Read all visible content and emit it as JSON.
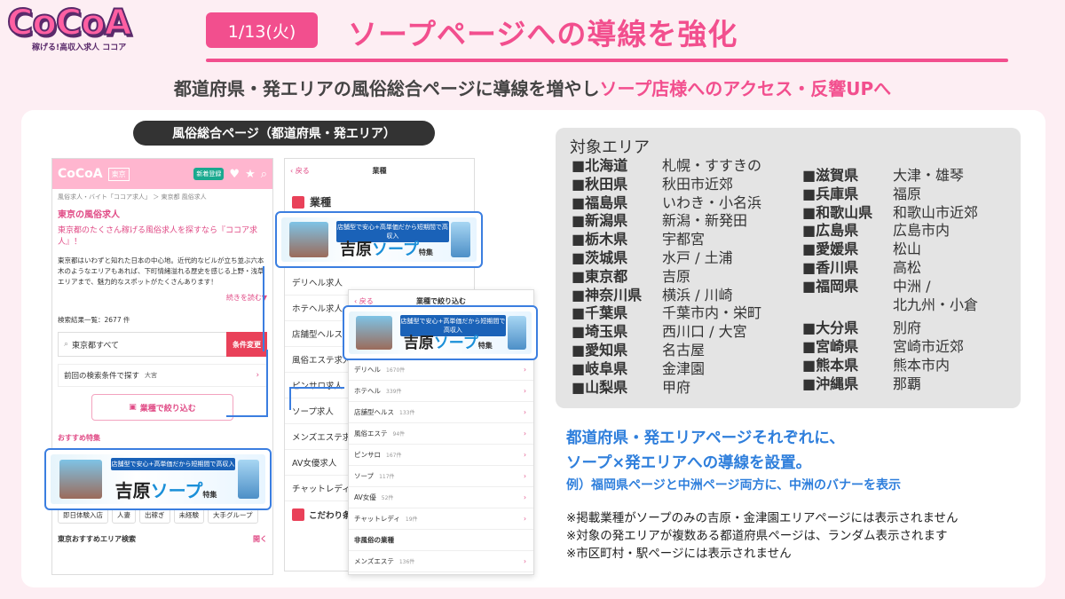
{
  "logo": {
    "brand": "CoCoA",
    "sub": "稼げる!高収入求人 ココア"
  },
  "header": {
    "date": "1/13(火)",
    "headline": "ソープページへの導線を強化"
  },
  "subline": {
    "part1": "都道府県・発エリアの風俗総合ページに導線を増やし",
    "part2": "ソープ店様へのアクセス・反響UPへ"
  },
  "screens_caption": "風俗総合ページ（都道府県・発エリア）",
  "banner": {
    "strip": "店舗型で安心+高単価だから短期間で高収入",
    "main_pre": "吉原",
    "main_so": "ソープ",
    "tokushu": "特集"
  },
  "phone1": {
    "area_btn": "東京",
    "new_btn": "新着登録",
    "crumb": "風俗求人・バイト「ココア求人」 ＞ 東京都 風俗求人",
    "h1": "東京の風俗求人",
    "lead": "東京都のたくさん稼げる風俗求人を探すなら『ココア求人』！",
    "body": "東京都はいわずと知れた日本の中心地。近代的なビルが立ち並ぶ六本木のようなエリアもあれば、下町情緒溢れる歴史を感じる上野・浅草エリアまで、魅力的なスポットがたくさんあります！",
    "more": "続きを読む▼",
    "count": "検索結果一覧：2677 件",
    "search": "東京都すべて",
    "change": "条件変更",
    "prev": "前回の検索条件で探す",
    "prev_sub": "大宮",
    "filter": "業種で絞り込む",
    "rec": "おすすめ特集",
    "tags": [
      "即日体験入店",
      "人妻",
      "出稼ぎ",
      "未経験",
      "大手グループ"
    ],
    "foot": "東京おすすめエリア検索",
    "foot_open": "開く"
  },
  "phone2": {
    "back": "戻る",
    "title": "業種",
    "section": "業種",
    "items": [
      "デリヘル求人",
      "ホテヘル求人",
      "店舗型ヘルス求",
      "風俗エステ求人",
      "ピンサロ求人",
      "ソープ求人",
      "メンズエステ求",
      "AV女優求人",
      "チャットレディ"
    ],
    "kodawari": "こだわり条"
  },
  "phone3": {
    "back": "戻る",
    "title": "業種で絞り込む",
    "items": [
      {
        "name": "デリヘル",
        "count": "1670件"
      },
      {
        "name": "ホテヘル",
        "count": "339件"
      },
      {
        "name": "店舗型ヘルス",
        "count": "133件"
      },
      {
        "name": "風俗エステ",
        "count": "94件"
      },
      {
        "name": "ピンサロ",
        "count": "167件"
      },
      {
        "name": "ソープ",
        "count": "117件"
      },
      {
        "name": "AV女優",
        "count": "52件"
      },
      {
        "name": "チャットレディ",
        "count": "19件"
      },
      {
        "name": "非風俗の業種",
        "count": ""
      },
      {
        "name": "メンズエステ",
        "count": "136件"
      }
    ]
  },
  "areas": {
    "title": "対象エリア",
    "left": [
      {
        "pref": "■北海道",
        "city": "札幌・すすきの"
      },
      {
        "pref": "■秋田県",
        "city": "秋田市近郊"
      },
      {
        "pref": "■福島県",
        "city": "いわき・小名浜"
      },
      {
        "pref": "■新潟県",
        "city": "新潟・新発田"
      },
      {
        "pref": "■栃木県",
        "city": "宇都宮"
      },
      {
        "pref": "■茨城県",
        "city": "水戸 / 土浦"
      },
      {
        "pref": "■東京都",
        "city": "吉原"
      },
      {
        "pref": "■神奈川県",
        "city": "横浜 / 川崎"
      },
      {
        "pref": "■千葉県",
        "city": "千葉市内・栄町"
      },
      {
        "pref": "■埼玉県",
        "city": "西川口 / 大宮"
      },
      {
        "pref": "■愛知県",
        "city": "名古屋"
      },
      {
        "pref": "■岐阜県",
        "city": "金津園"
      },
      {
        "pref": "■山梨県",
        "city": "甲府"
      }
    ],
    "right": [
      {
        "pref": "■滋賀県",
        "city": "大津・雄琴"
      },
      {
        "pref": "■兵庫県",
        "city": "福原"
      },
      {
        "pref": "■和歌山県",
        "city": "和歌山市近郊"
      },
      {
        "pref": "■広島県",
        "city": "広島市内"
      },
      {
        "pref": "■愛媛県",
        "city": "松山"
      },
      {
        "pref": "■香川県",
        "city": "高松"
      },
      {
        "pref": "■福岡県",
        "city": "中洲 /"
      },
      {
        "pref": "",
        "city": "北九州・小倉"
      },
      {
        "pref": "■大分県",
        "city": "別府"
      },
      {
        "pref": "■宮崎県",
        "city": "宮崎市近郊"
      },
      {
        "pref": "■熊本県",
        "city": "熊本市内"
      },
      {
        "pref": "■沖縄県",
        "city": "那覇"
      }
    ]
  },
  "explain": {
    "l1": "都道府県・発エリアページそれぞれに、",
    "l2": "ソープ×発エリアへの導線を設置。",
    "l3": "例）福岡県ページと中洲ページ両方に、中洲のバナーを表示"
  },
  "notes": [
    "※掲載業種がソープのみの吉原・金津園エリアページには表示されません",
    "※対象の発エリアが複数ある都道府県ページは、ランダム表示されます",
    "※市区町村・駅ページには表示されません"
  ]
}
